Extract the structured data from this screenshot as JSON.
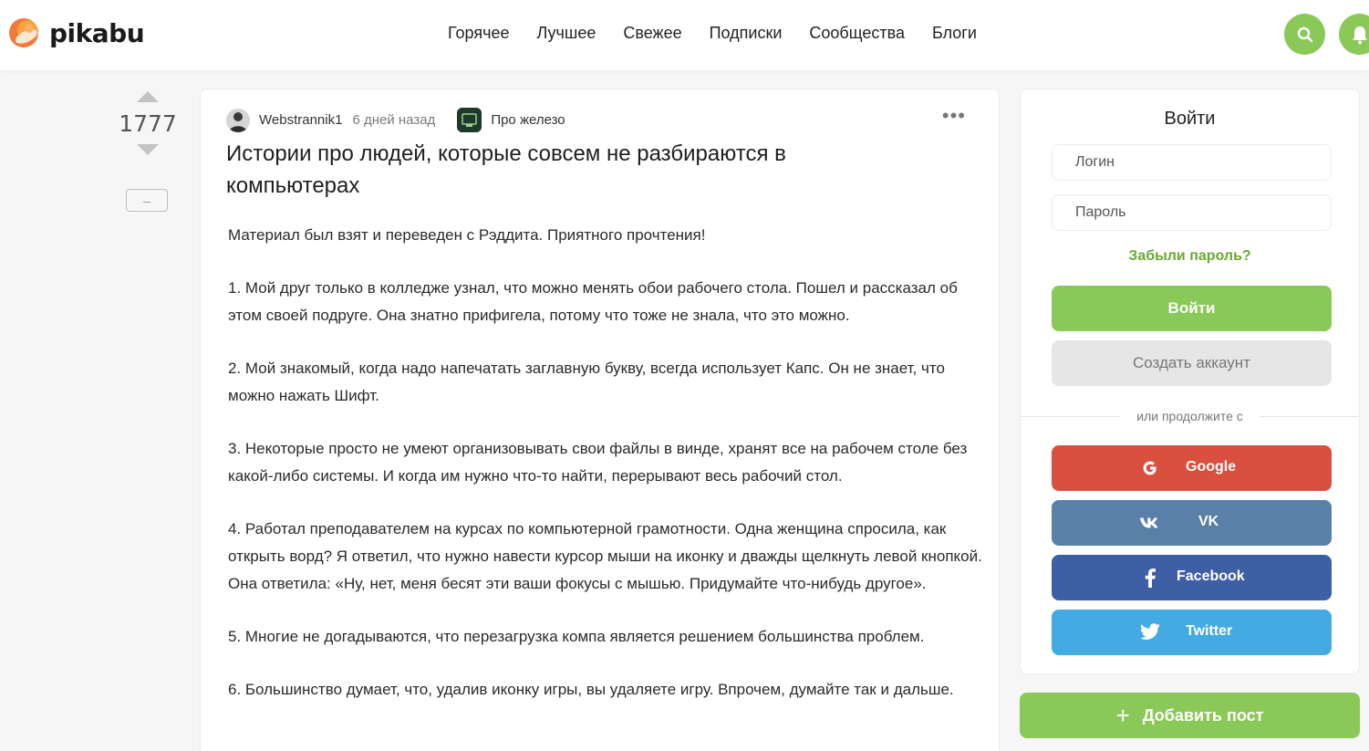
{
  "header": {
    "logo_text": "pikabu",
    "nav": [
      "Горячее",
      "Лучшее",
      "Свежее",
      "Подписки",
      "Сообщества",
      "Блоги"
    ],
    "icons": {
      "search": "search-icon",
      "notifications": "bell-icon"
    },
    "accent_color": "#8ac858"
  },
  "rating": {
    "count": "1777",
    "collapse_label": "–"
  },
  "post": {
    "author": "Webstrannik1",
    "time": "6 дней назад",
    "community": "Про железо",
    "more": "•••",
    "title": "Истории про людей, которые совсем не разбираются в компьютерах",
    "paragraphs": [
      "Материал был взят и переведен с Рэддита. Приятного прочтения!",
      "1. Мой друг только в колледже узнал, что можно менять обои рабочего стола. Пошел и рассказал об этом своей подруге. Она знатно прифигела, потому что тоже не знала, что это можно.",
      "2. Мой знакомый, когда надо напечатать заглавную букву, всегда использует Капс. Он не знает, что можно нажать Шифт.",
      "3. Некоторые просто не умеют организовывать свои файлы в винде, хранят все на рабочем столе без какой-либо системы. И когда им нужно что-то найти, перерывают весь рабочий стол.",
      "4. Работал преподавателем на курсах по компьютерной грамотности. Одна женщина спросила, как открыть ворд? Я ответил, что нужно навести курсор мыши на иконку и дважды щелкнуть левой кнопкой. Она ответила: «Ну, нет, меня бесят эти ваши фокусы с мышью. Придумайте что-нибудь другое».",
      "5. Многие не догадываются, что перезагрузка компа является решением большинства проблем.",
      "6. Большинство думает, что, удалив иконку игры, вы удаляете игру. Впрочем, думайте так и дальше."
    ]
  },
  "login": {
    "title": "Войти",
    "login_placeholder": "Логин",
    "password_placeholder": "Пароль",
    "forgot": "Забыли пароль?",
    "login_button": "Войти",
    "create_button": "Создать аккаунт",
    "or_text": "или продолжите с",
    "social": {
      "google": "Google",
      "vk": "VK",
      "facebook": "Facebook",
      "twitter": "Twitter"
    }
  },
  "add_post": {
    "plus": "+",
    "label": "Добавить пост"
  }
}
